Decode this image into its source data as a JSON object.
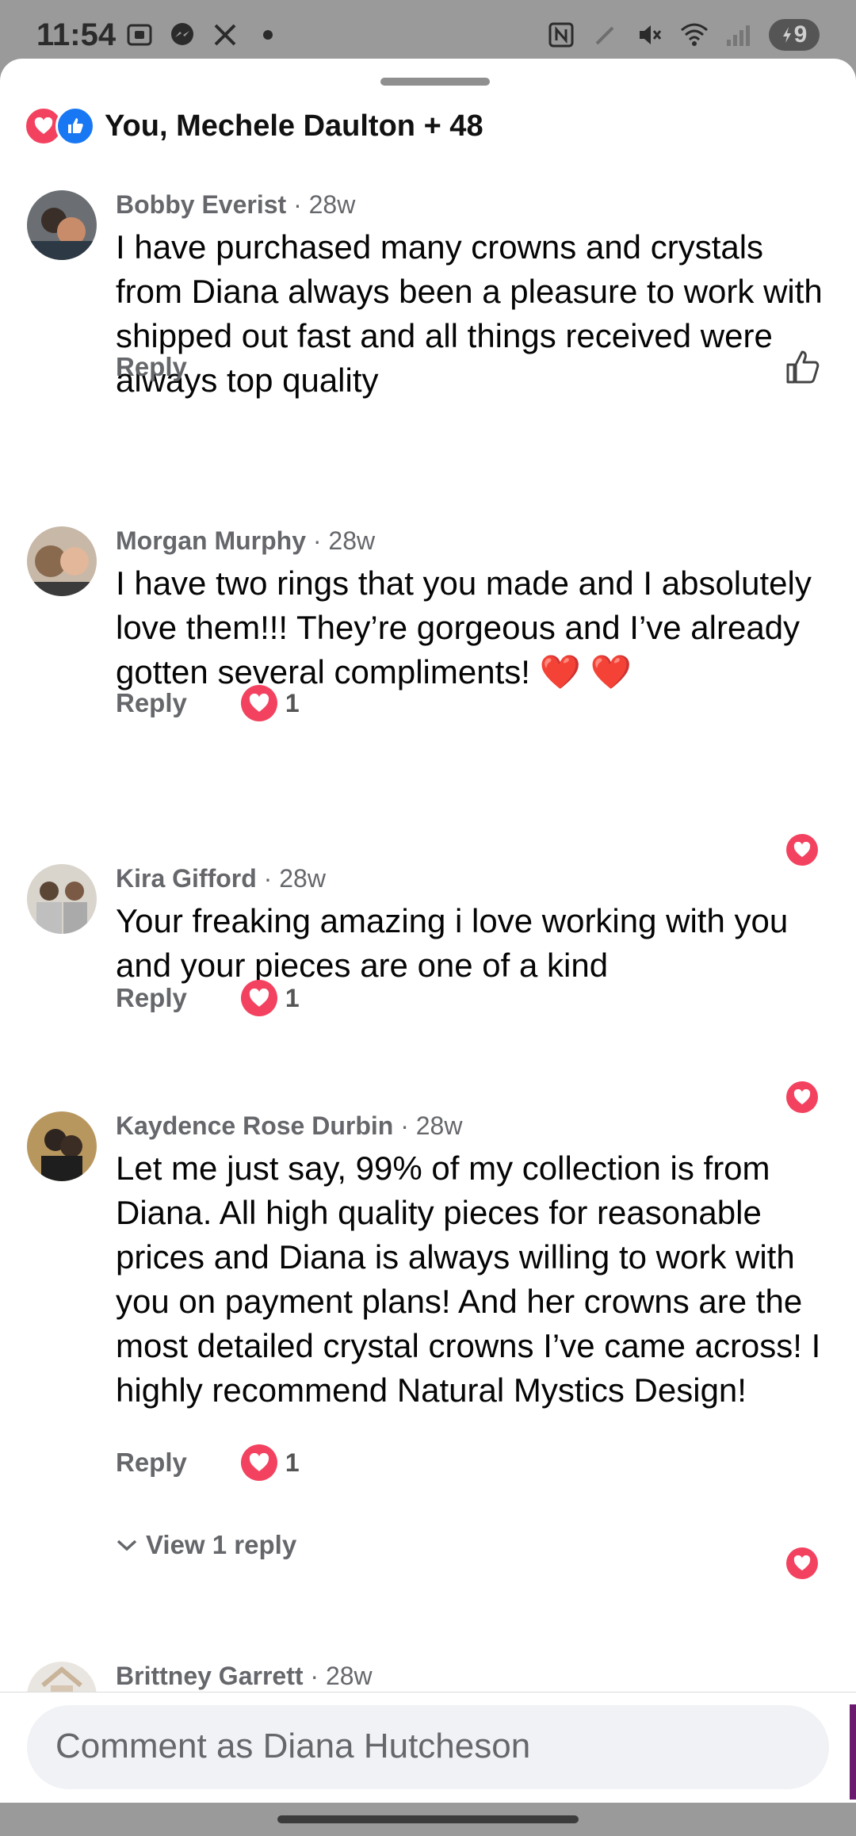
{
  "status_bar": {
    "time": "11:54",
    "battery": "9",
    "left_icons": [
      "screenshot-icon",
      "messenger-icon",
      "tools-icon",
      "dot-icon"
    ],
    "right_icons": [
      "nfc-icon",
      "pen-icon",
      "mute-icon",
      "wifi-icon",
      "signal-icon"
    ]
  },
  "reactions": {
    "summary": "You, Mechele Daulton + 48",
    "types": [
      "love",
      "like"
    ]
  },
  "comments": [
    {
      "name": "Bobby Everist",
      "time": "· 28w",
      "text": "I have purchased many crowns and crystals from Diana always been a pleasure to work with shipped out fast and all things received were always top quality",
      "reply_label": "Reply",
      "reaction_count": "",
      "right_action": "like-outline"
    },
    {
      "name": "Morgan Murphy",
      "time": "· 28w",
      "text": "I have two rings that you made and I absolutely love them!!! They’re gorgeous and I’ve already gotten several compliments! ❤️ ❤️",
      "reply_label": "Reply",
      "reaction_count": "1",
      "right_action": "love"
    },
    {
      "name": "Kira Gifford",
      "time": "· 28w",
      "text": "Your freaking amazing i love working with you and your pieces are one of a kind",
      "reply_label": "Reply",
      "reaction_count": "1",
      "right_action": "love"
    },
    {
      "name": "Kaydence Rose Durbin",
      "time": "· 28w",
      "text": "Let me just say, 99% of my collection is from Diana. All high quality pieces for reasonable prices and Diana is always willing to work with you on payment plans! And her crowns are the most detailed crystal crowns I’ve came across! I highly recommend Natural Mystics Design!",
      "reply_label": "Reply",
      "reaction_count": "1",
      "right_action": "love",
      "view_replies": "View 1 reply"
    },
    {
      "name": "Brittney Garrett",
      "time": "· 28w"
    }
  ],
  "composer": {
    "placeholder": "Comment as Diana Hutcheson"
  },
  "colors": {
    "love": "#f3425f",
    "like": "#1877f2",
    "secondary_text": "#65676b"
  }
}
